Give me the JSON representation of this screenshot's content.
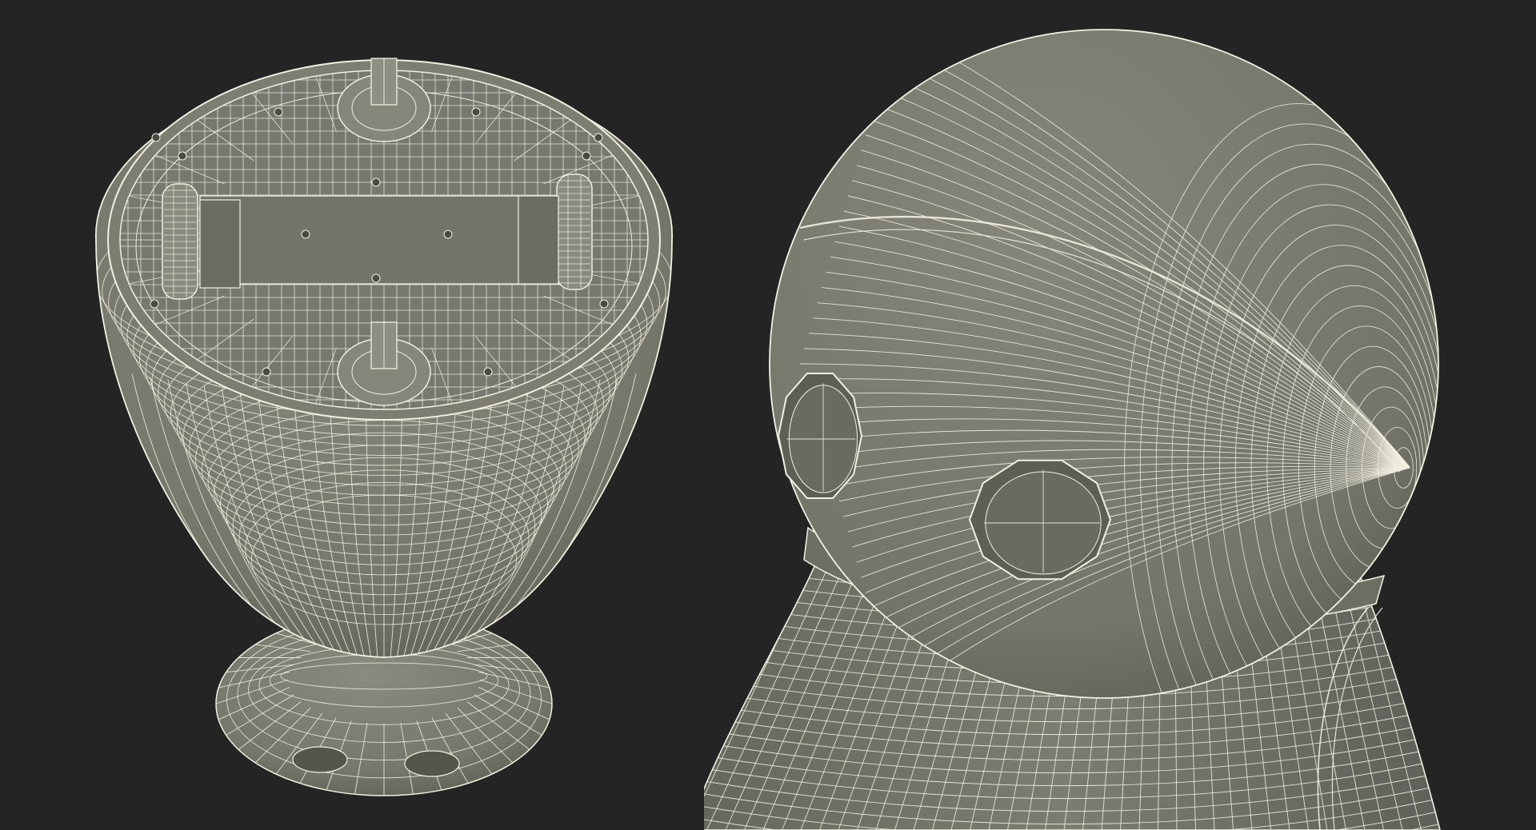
{
  "scene": {
    "background_color": "#242424",
    "model_fill": "#7a7a6e",
    "model_fill_dark": "#5f5f55",
    "wire_color": "#f2f0e0",
    "panels": [
      {
        "name": "bottom-view",
        "subject": "robot-base-underside-wireframe"
      },
      {
        "name": "closeup-view",
        "subject": "robot-head-sphere-wireframe"
      }
    ]
  }
}
